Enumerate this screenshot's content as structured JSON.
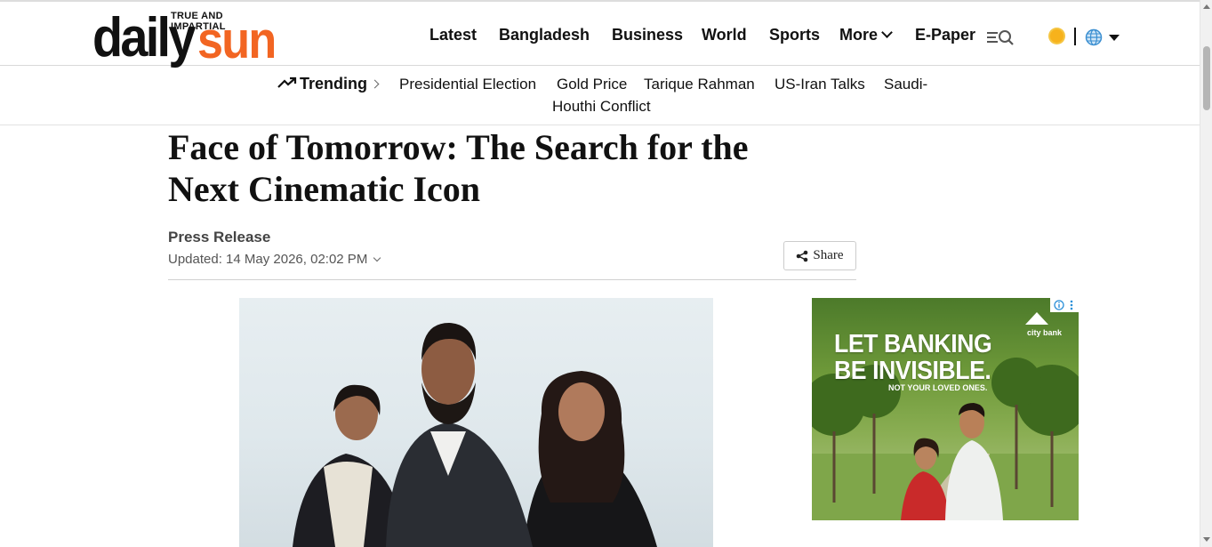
{
  "brand": {
    "name_part1": "daily",
    "name_part2": "sun",
    "tagline": "TRUE AND IMPARTIAL",
    "accent_color": "#f26522"
  },
  "nav": {
    "items": [
      "Latest",
      "Bangladesh",
      "Business",
      "World",
      "Sports"
    ],
    "more_label": "More",
    "epaper_label": "E-Paper",
    "icons": [
      "menu-search-icon",
      "theme-sun-icon",
      "globe-icon",
      "caret-down-icon"
    ]
  },
  "trending": {
    "label": "Trending",
    "items": [
      "Presidential Election",
      "Gold Price",
      "Tarique Rahman",
      "US-Iran Talks",
      "Saudi-",
      "Houthi Conflict"
    ]
  },
  "article": {
    "headline_line1": "Face of Tomorrow: The Search for the",
    "headline_line2": "Next Cinematic Icon",
    "author": "Press Release",
    "updated": "Updated: 14 May 2026, 02:02 PM",
    "share_label": "Share"
  },
  "ad": {
    "headline_line1": "LET BANKING",
    "headline_line2": "BE INVISIBLE.",
    "subline": "NOT YOUR LOVED ONES.",
    "brand": "city bank"
  }
}
